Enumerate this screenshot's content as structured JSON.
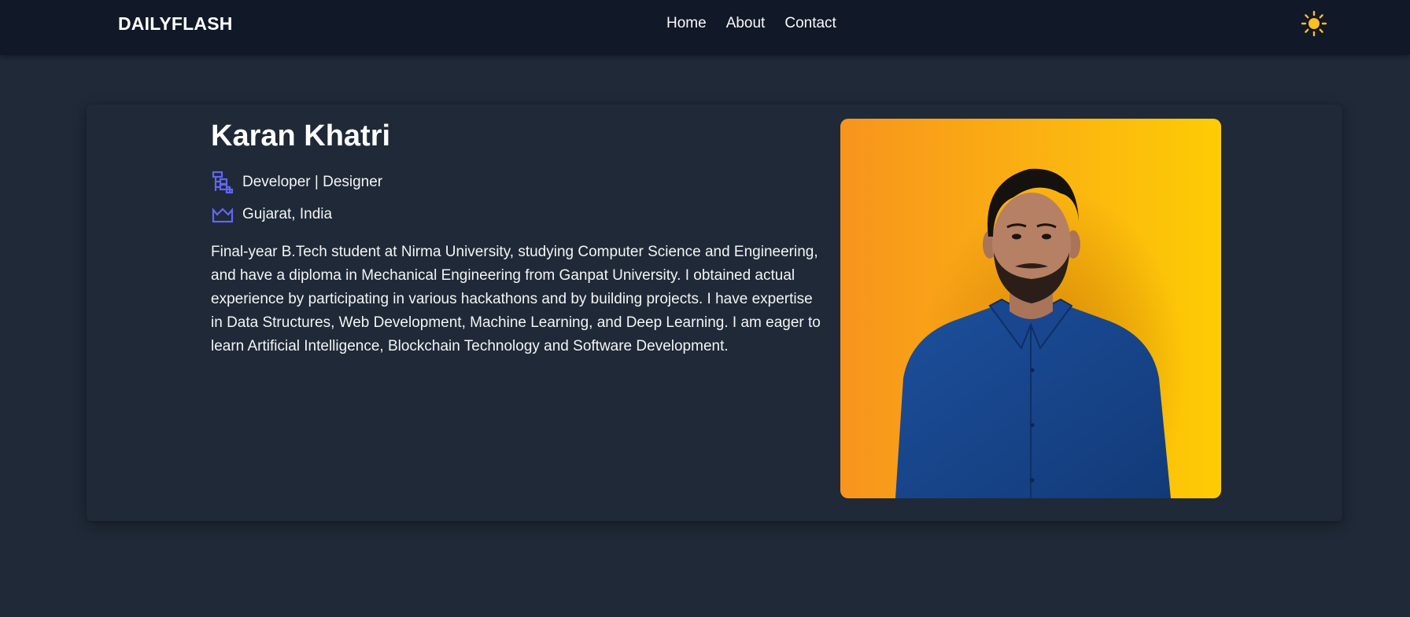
{
  "header": {
    "brand": "DAILYFLASH",
    "nav": [
      "Home",
      "About",
      "Contact"
    ],
    "theme_icon": "sun-icon"
  },
  "profile": {
    "name": "Karan Khatri",
    "role": "Developer | Designer",
    "role_icon": "sitemap-icon",
    "location": "Gujarat, India",
    "location_icon": "crown-icon",
    "bio": "Final-year B.Tech student at Nirma University, studying Computer Science and Engineering, and have a diploma in Mechanical Engineering from Ganpat University. I obtained actual experience by participating in various hackathons and by building projects. I have expertise in Data Structures, Web Development, Machine Learning, and Deep Learning. I am eager to learn Artificial Intelligence, Blockchain Technology and Software Development."
  },
  "colors": {
    "nav_bg": "#111827",
    "page_bg": "#1f2937",
    "icon_accent": "#6366f1",
    "sun": "#fbbf24",
    "photo_bg_start": "#f7941d",
    "photo_bg_end": "#fdcc04"
  }
}
